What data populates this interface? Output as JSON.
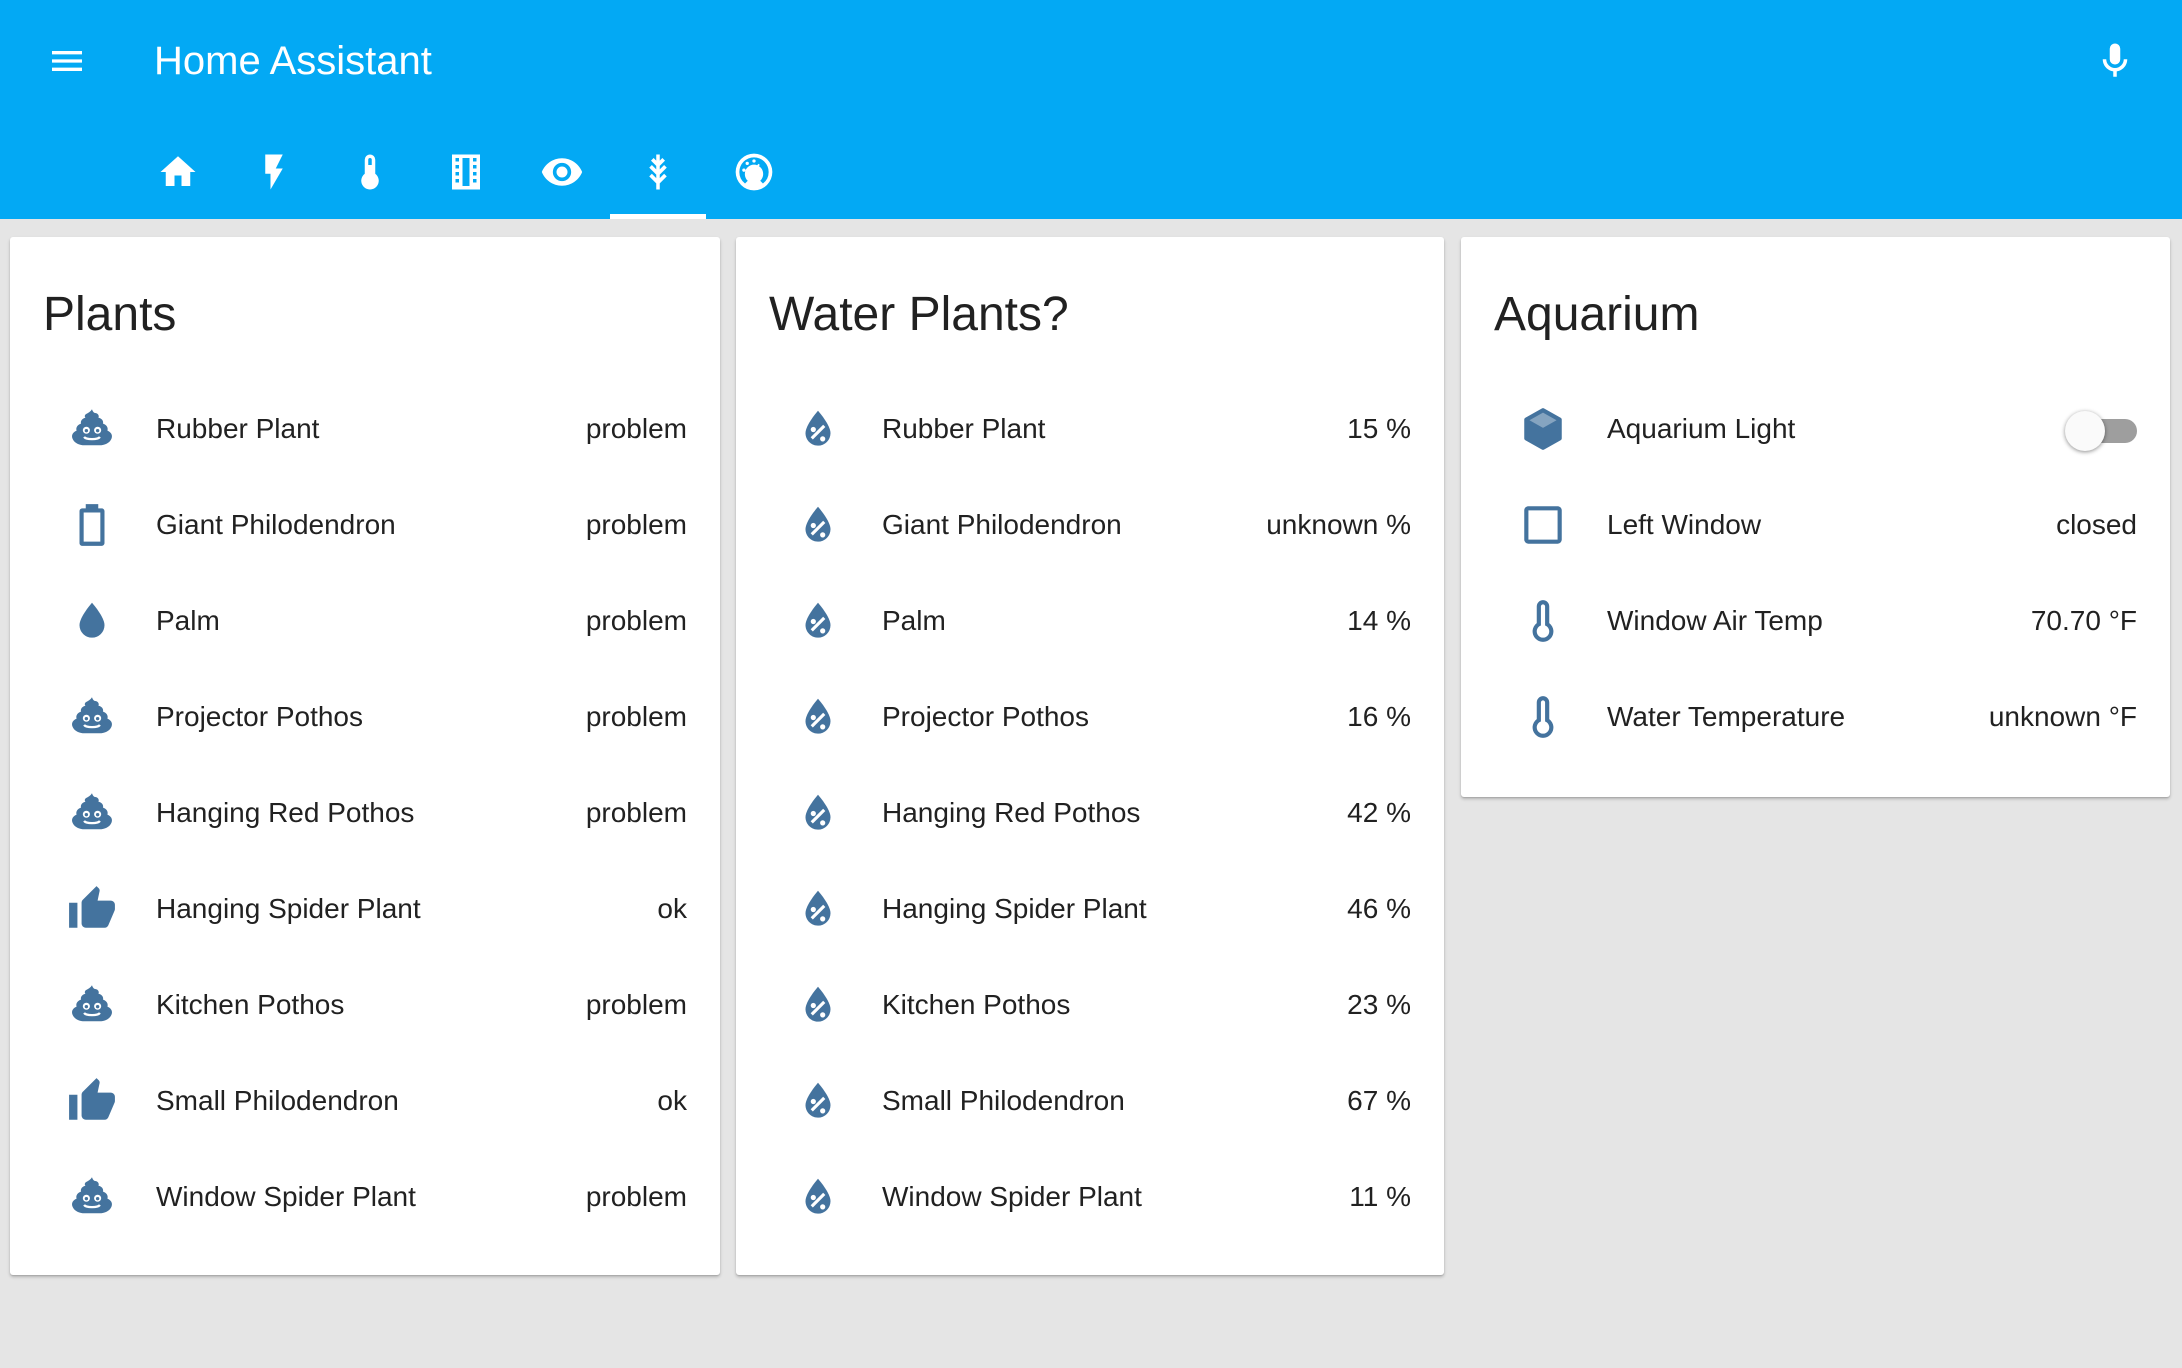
{
  "colors": {
    "header": "#03a9f4",
    "icon": "#44739e",
    "background": "#e5e5e5",
    "text": "#212121"
  },
  "header": {
    "title": "Home Assistant",
    "tabs": [
      {
        "icon": "home-icon"
      },
      {
        "icon": "flash-icon"
      },
      {
        "icon": "thermometer-icon"
      },
      {
        "icon": "film-icon"
      },
      {
        "icon": "eye-icon"
      },
      {
        "icon": "grain-icon",
        "active": true
      },
      {
        "icon": "gauge-icon"
      }
    ]
  },
  "cards": {
    "plants": {
      "title": "Plants",
      "rows": [
        {
          "name": "Rubber Plant",
          "state": "problem",
          "icon": "poop-icon"
        },
        {
          "name": "Giant Philodendron",
          "state": "problem",
          "icon": "battery-outline-icon"
        },
        {
          "name": "Palm",
          "state": "problem",
          "icon": "water-drop-icon"
        },
        {
          "name": "Projector Pothos",
          "state": "problem",
          "icon": "poop-icon"
        },
        {
          "name": "Hanging Red Pothos",
          "state": "problem",
          "icon": "poop-icon"
        },
        {
          "name": "Hanging Spider Plant",
          "state": "ok",
          "icon": "thumb-up-icon"
        },
        {
          "name": "Kitchen Pothos",
          "state": "problem",
          "icon": "poop-icon"
        },
        {
          "name": "Small Philodendron",
          "state": "ok",
          "icon": "thumb-up-icon"
        },
        {
          "name": "Window Spider Plant",
          "state": "problem",
          "icon": "poop-icon"
        }
      ]
    },
    "water": {
      "title": "Water Plants?",
      "rows": [
        {
          "name": "Rubber Plant",
          "state": "15 %",
          "icon": "water-percent-icon"
        },
        {
          "name": "Giant Philodendron",
          "state": "unknown %",
          "icon": "water-percent-icon"
        },
        {
          "name": "Palm",
          "state": "14 %",
          "icon": "water-percent-icon"
        },
        {
          "name": "Projector Pothos",
          "state": "16 %",
          "icon": "water-percent-icon"
        },
        {
          "name": "Hanging Red Pothos",
          "state": "42 %",
          "icon": "water-percent-icon"
        },
        {
          "name": "Hanging Spider Plant",
          "state": "46 %",
          "icon": "water-percent-icon"
        },
        {
          "name": "Kitchen Pothos",
          "state": "23 %",
          "icon": "water-percent-icon"
        },
        {
          "name": "Small Philodendron",
          "state": "67 %",
          "icon": "water-percent-icon"
        },
        {
          "name": "Window Spider Plant",
          "state": "11 %",
          "icon": "water-percent-icon"
        }
      ]
    },
    "aquarium": {
      "title": "Aquarium",
      "rows": [
        {
          "name": "Aquarium Light",
          "state": "off",
          "icon": "cube-icon",
          "control": "toggle"
        },
        {
          "name": "Left Window",
          "state": "closed",
          "icon": "checkbox-blank-outline-icon"
        },
        {
          "name": "Window Air Temp",
          "state": "70.70 °F",
          "icon": "thermometer-icon"
        },
        {
          "name": "Water Temperature",
          "state": "unknown °F",
          "icon": "thermometer-icon"
        }
      ]
    }
  }
}
